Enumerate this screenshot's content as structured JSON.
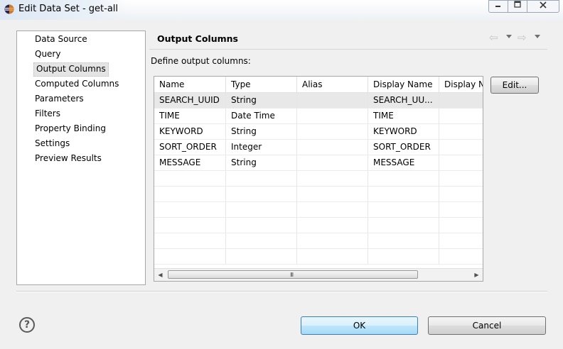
{
  "window": {
    "title": "Edit Data Set - get-all",
    "controls": [
      "minimize-icon",
      "maximize-icon",
      "close-icon"
    ]
  },
  "nav": {
    "items": [
      {
        "label": "Data Source"
      },
      {
        "label": "Query"
      },
      {
        "label": "Output Columns",
        "selected": true
      },
      {
        "label": "Computed Columns"
      },
      {
        "label": "Parameters"
      },
      {
        "label": "Filters"
      },
      {
        "label": "Property Binding"
      },
      {
        "label": "Settings"
      },
      {
        "label": "Preview Results"
      }
    ]
  },
  "page": {
    "header": "Output Columns",
    "description": "Define output columns:",
    "icons": [
      "back-arrow-icon",
      "forward-arrow-icon"
    ]
  },
  "table": {
    "columns": [
      "Name",
      "Type",
      "Alias",
      "Display Name",
      "Display N"
    ],
    "rows": [
      [
        "SEARCH_UUID",
        "String",
        "",
        "SEARCH_UU...",
        ""
      ],
      [
        "TIME",
        "Date Time",
        "",
        "TIME",
        ""
      ],
      [
        "KEYWORD",
        "String",
        "",
        "KEYWORD",
        ""
      ],
      [
        "SORT_ORDER",
        "Integer",
        "",
        "SORT_ORDER",
        ""
      ],
      [
        "MESSAGE",
        "String",
        "",
        "MESSAGE",
        ""
      ]
    ],
    "selected_row": 0,
    "scrollbar_grip": "III"
  },
  "buttons": {
    "edit": "Edit...",
    "ok": "OK",
    "cancel": "Cancel",
    "help": "?"
  },
  "colors": {
    "accent_button": "#3c7fb1",
    "selection": "#e8e8e8"
  }
}
